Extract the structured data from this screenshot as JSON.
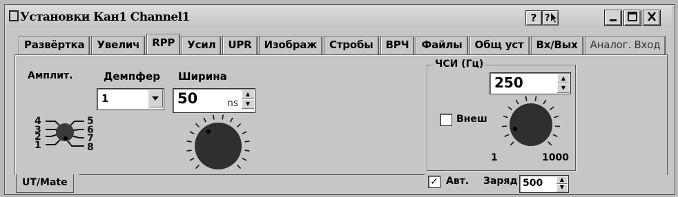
{
  "window": {
    "title": "Установки Кан1 Channel1",
    "help_label": "?",
    "whatsthis_label": "?\\",
    "minimize_label": "_",
    "maximize_label": "□",
    "close_label": "X"
  },
  "tabs": [
    {
      "label": "Развёртка"
    },
    {
      "label": "Увелич"
    },
    {
      "label": "RPP",
      "active": true
    },
    {
      "label": "Усил"
    },
    {
      "label": "UPR"
    },
    {
      "label": "Изображ"
    },
    {
      "label": "Стробы"
    },
    {
      "label": "ВРЧ"
    },
    {
      "label": "Файлы"
    },
    {
      "label": "Общ уст"
    },
    {
      "label": "Вх/Вых"
    },
    {
      "label": "Аналог. Вход"
    }
  ],
  "amplitude": {
    "label": "Амплит.",
    "positions": [
      "1",
      "2",
      "3",
      "4",
      "5",
      "6",
      "7",
      "8"
    ]
  },
  "damper": {
    "label": "Демпфер",
    "value": "1"
  },
  "width": {
    "label": "Ширина",
    "value": "50",
    "unit": "ns"
  },
  "pri": {
    "group_title": "ЧСИ (Гц)",
    "value": "250",
    "external_label": "Внеш",
    "external_checked": false,
    "scale_min": "1",
    "scale_max": "1000"
  },
  "auto": {
    "label": "Авт.",
    "checked": true,
    "check_mark": "✓"
  },
  "charge": {
    "label": "Заряд",
    "value": "500"
  },
  "bottom_tab": {
    "label": "UT/Mate"
  },
  "colors": {
    "window_bg": "#c6c6c6",
    "knob": "#2f2f2f"
  }
}
